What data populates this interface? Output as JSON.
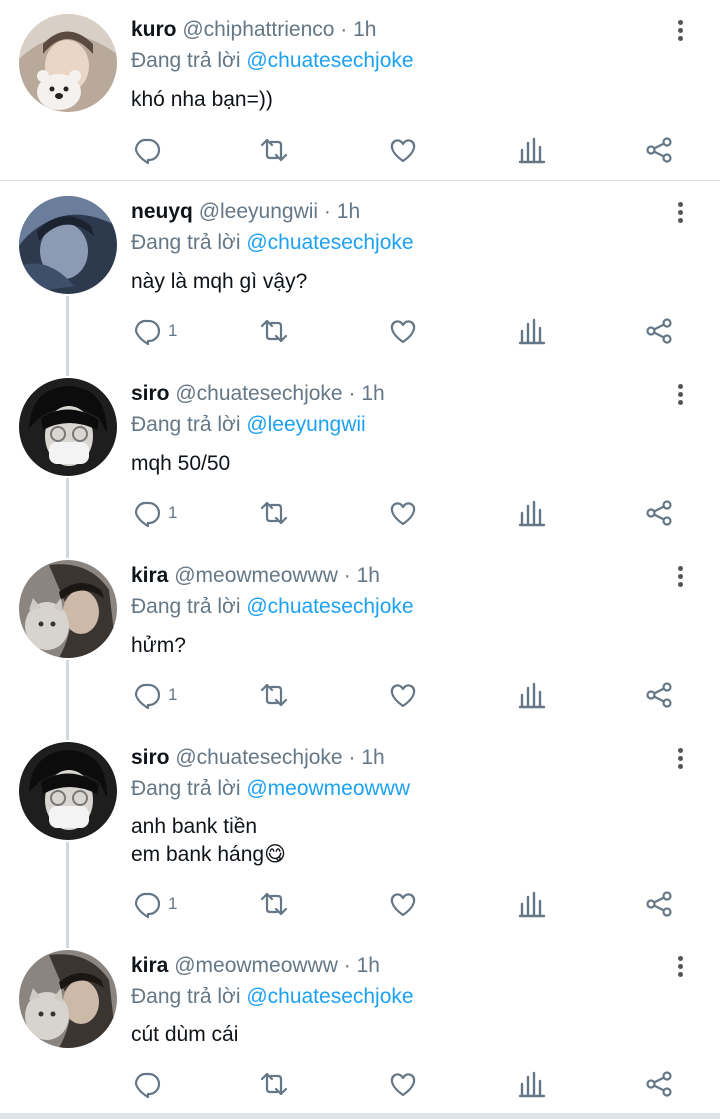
{
  "reply_prefix": "Đang trả lời",
  "tweets": [
    {
      "name": "kuro",
      "handle": "@chiphattrienco",
      "sep": "·",
      "time": "1h",
      "reply_to": "@chuatesechjoke",
      "text": "khó nha bạn=))",
      "reply_count": ""
    },
    {
      "name": "neuyq",
      "handle": "@leeyungwii",
      "sep": "·",
      "time": "1h",
      "reply_to": "@chuatesechjoke",
      "text": "này là mqh gì vậy?",
      "reply_count": "1"
    },
    {
      "name": "siro",
      "handle": "@chuatesechjoke",
      "sep": "·",
      "time": "1h",
      "reply_to": "@leeyungwii",
      "text": "mqh 50/50",
      "reply_count": "1"
    },
    {
      "name": "kira",
      "handle": "@meowmeowww",
      "sep": "·",
      "time": "1h",
      "reply_to": "@chuatesechjoke",
      "text": "hửm?",
      "reply_count": "1"
    },
    {
      "name": "siro",
      "handle": "@chuatesechjoke",
      "sep": "·",
      "time": "1h",
      "reply_to": "@meowmeowww",
      "text": "anh bank tiền\nem bank háng😋",
      "reply_count": "1"
    },
    {
      "name": "kira",
      "handle": "@meowmeowww",
      "sep": "·",
      "time": "1h",
      "reply_to": "@chuatesechjoke",
      "text": "cút dùm cái",
      "reply_count": ""
    }
  ],
  "icons": {
    "reply": "reply-icon",
    "retweet": "retweet-icon",
    "like": "heart-icon",
    "stats": "bar-chart-icon",
    "share": "share-icon",
    "more": "more-vertical-icon"
  },
  "colors": {
    "mention": "#1da1f2",
    "muted": "#657786",
    "icon": "#657786"
  }
}
